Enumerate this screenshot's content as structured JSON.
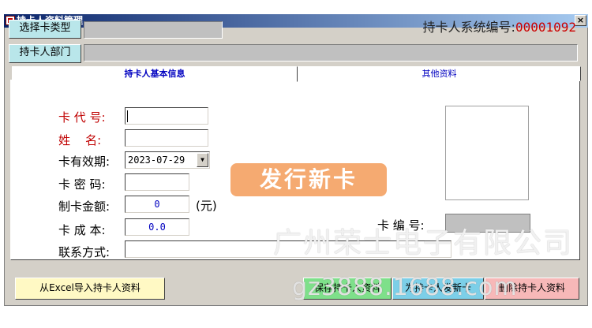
{
  "window": {
    "title": "持卡人资料管理",
    "close_label": "×"
  },
  "header": {
    "card_type_button": "选择卡类型",
    "department_button": "持卡人部门",
    "system_no_label": "持卡人系统编号:",
    "system_no_value": "00001092"
  },
  "tabs": {
    "basic": "持卡人基本信息",
    "other": "其他资料"
  },
  "form": {
    "card_code_label": "卡 代 号:",
    "name_label": "姓    名:",
    "expiry_label": "卡有效期:",
    "expiry_value": "2023-07-29",
    "password_label": "卡 密 码:",
    "fee_label": "制卡金额:",
    "fee_value": "0",
    "fee_unit": "(元)",
    "cost_label": "卡 成 本:",
    "cost_value": "0.0",
    "contact_label": "联系方式:",
    "card_number_label": "卡 编 号:"
  },
  "banner": {
    "issue_new_card": "发行新卡"
  },
  "watermark": {
    "company": "广州荣士电子有限公司",
    "site": "gz3888.1688.com"
  },
  "buttons": {
    "import_excel": "从Excel导入持卡人资料",
    "save": "保存持卡人资料",
    "issue": "为持卡人发新卡",
    "delete": "删除持卡人资料"
  },
  "colors": {
    "accent_red": "#cc0000",
    "banner": "#f5a66a",
    "save": "#7ee08a",
    "issue": "#7ccfe8",
    "delete": "#f7b8b8"
  }
}
